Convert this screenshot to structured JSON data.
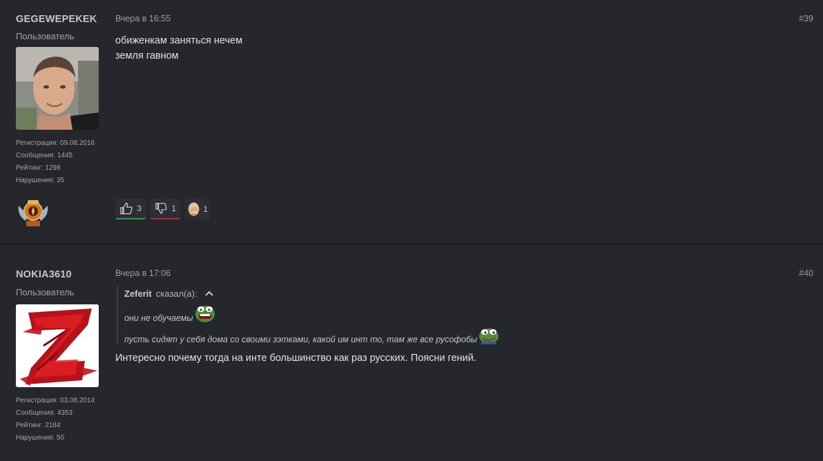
{
  "posts": [
    {
      "username": "GEGEWEPEKEK",
      "role": "Пользователь",
      "stats": {
        "reg": "Регистрация: 09.08.2016",
        "msgs": "Сообщения: 1445",
        "rating": "Рейтинг: 1298",
        "violations": "Нарушения: 35"
      },
      "time": "Вчера в 16:55",
      "number": "#39",
      "lines": [
        "обиженкам заняться нечем",
        "земля гавном"
      ],
      "reactions": {
        "like": "3",
        "dislike": "1",
        "emoji": "1"
      }
    },
    {
      "username": "NOKIA3610",
      "role": "Пользователь",
      "stats": {
        "reg": "Регистрация: 03.08.2014",
        "msgs": "Сообщения: 4353",
        "rating": "Рейтинг: 2184",
        "violations": "Нарушения: 50"
      },
      "time": "Вчера в 17:06",
      "number": "#40",
      "quote": {
        "author": "Zeferit",
        "said": "сказал(а):",
        "line1": "они не обучаемы",
        "line2": "пусть сидят у себя дома со своими зэтками, какой им инт то, там же все русофобы"
      },
      "body": "Интересно почему тогда на инте большинство как раз русских. Поясни гений."
    }
  ],
  "colors": {
    "like": "#2e9a4d",
    "dislike": "#b0323a",
    "background": "#25272c"
  }
}
